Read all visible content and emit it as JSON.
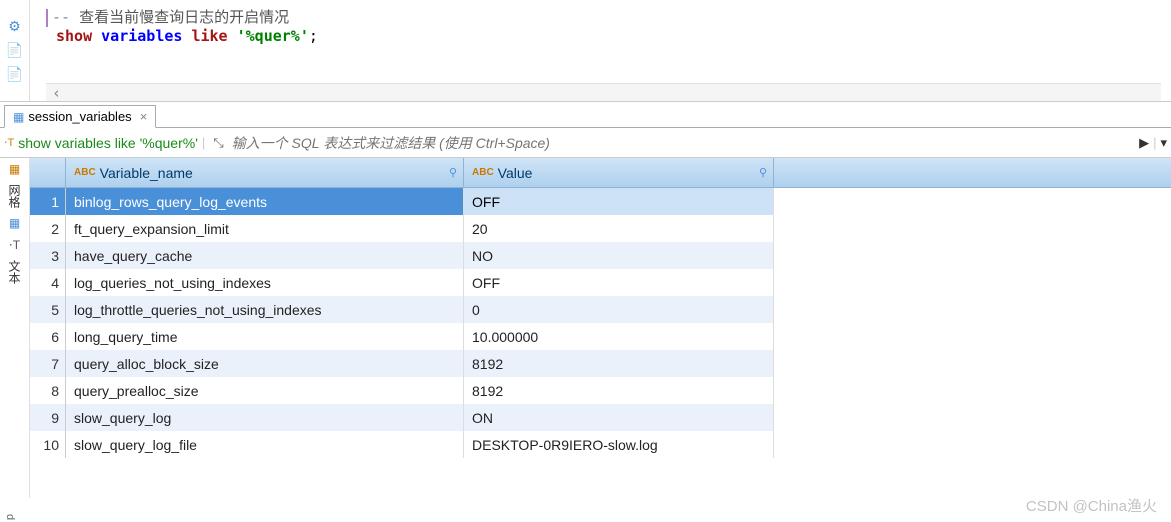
{
  "editor": {
    "comment_prefix": "-- ",
    "comment_text": "查看当前慢查询日志的开启情况",
    "sql_show": "show",
    "sql_variables": "variables",
    "sql_like": "like",
    "sql_string": "'%quer%'",
    "sql_semi": ";"
  },
  "scroll_left_marker": "‹",
  "tab": {
    "label": "session_variables",
    "close": "×"
  },
  "filter": {
    "sql_icon": "⋅T",
    "sql_text": "show variables like '%quer%'",
    "resize_icon": "⤡",
    "placeholder": "输入一个 SQL 表达式来过滤结果 (使用 Ctrl+Space)",
    "arrow_right": "▶",
    "dropdown": "▾"
  },
  "grid_left": {
    "label1": "网格",
    "label2": "文本"
  },
  "columns": {
    "name_type": "ABC",
    "name_label": "Variable_name",
    "value_type": "ABC",
    "value_label": "Value",
    "filter_icon": "⚲"
  },
  "rows": [
    {
      "n": "1",
      "name": "binlog_rows_query_log_events",
      "value": "OFF",
      "selected": true
    },
    {
      "n": "2",
      "name": "ft_query_expansion_limit",
      "value": "20",
      "selected": false
    },
    {
      "n": "3",
      "name": "have_query_cache",
      "value": "NO",
      "selected": false
    },
    {
      "n": "4",
      "name": "log_queries_not_using_indexes",
      "value": "OFF",
      "selected": false
    },
    {
      "n": "5",
      "name": "log_throttle_queries_not_using_indexes",
      "value": "0",
      "selected": false
    },
    {
      "n": "6",
      "name": "long_query_time",
      "value": "10.000000",
      "selected": false
    },
    {
      "n": "7",
      "name": "query_alloc_block_size",
      "value": "8192",
      "selected": false
    },
    {
      "n": "8",
      "name": "query_prealloc_size",
      "value": "8192",
      "selected": false
    },
    {
      "n": "9",
      "name": "slow_query_log",
      "value": "ON",
      "selected": false
    },
    {
      "n": "10",
      "name": "slow_query_log_file",
      "value": "DESKTOP-0R9IERO-slow.log",
      "selected": false
    }
  ],
  "watermark": "CSDN @China渔火",
  "bottom_label": "d"
}
